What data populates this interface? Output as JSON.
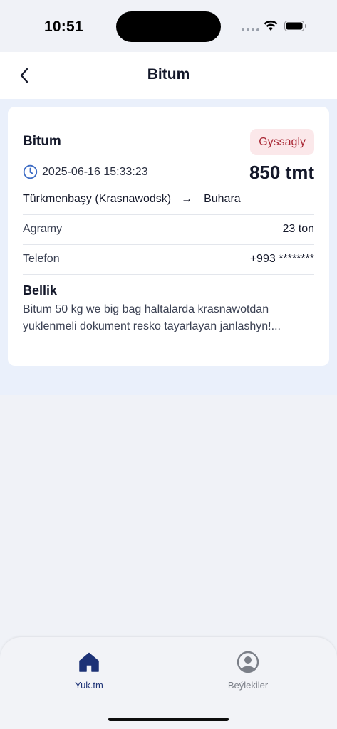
{
  "status_bar": {
    "time": "10:51"
  },
  "nav": {
    "title": "Bitum"
  },
  "card": {
    "title": "Bitum",
    "status": "Gyssagly",
    "date": "2025-06-16 15:33:23",
    "price": "850 tmt",
    "route": {
      "from": "Türkmenbaşy (Krasnawodsk)",
      "arrow": "→",
      "to": "Buhara"
    },
    "rows": [
      {
        "label": "Agramy",
        "value": "23 ton"
      },
      {
        "label": "Telefon",
        "value": "+993 ********"
      }
    ],
    "note": {
      "title": "Bellik",
      "text": "Bitum 50 kg we big bag haltalarda krasnawotdan yuklenmeli dokument resko tayarlayan janlashyn!..."
    }
  },
  "tabs": [
    {
      "label": "Yuk.tm",
      "icon": "home-icon",
      "active": true
    },
    {
      "label": "Beýlekiler",
      "icon": "profile-icon",
      "active": false
    }
  ],
  "colors": {
    "accent": "#1d3276",
    "badge_bg": "#fbe8ea",
    "badge_text": "#a82633",
    "clock_icon": "#3d6cc4"
  }
}
